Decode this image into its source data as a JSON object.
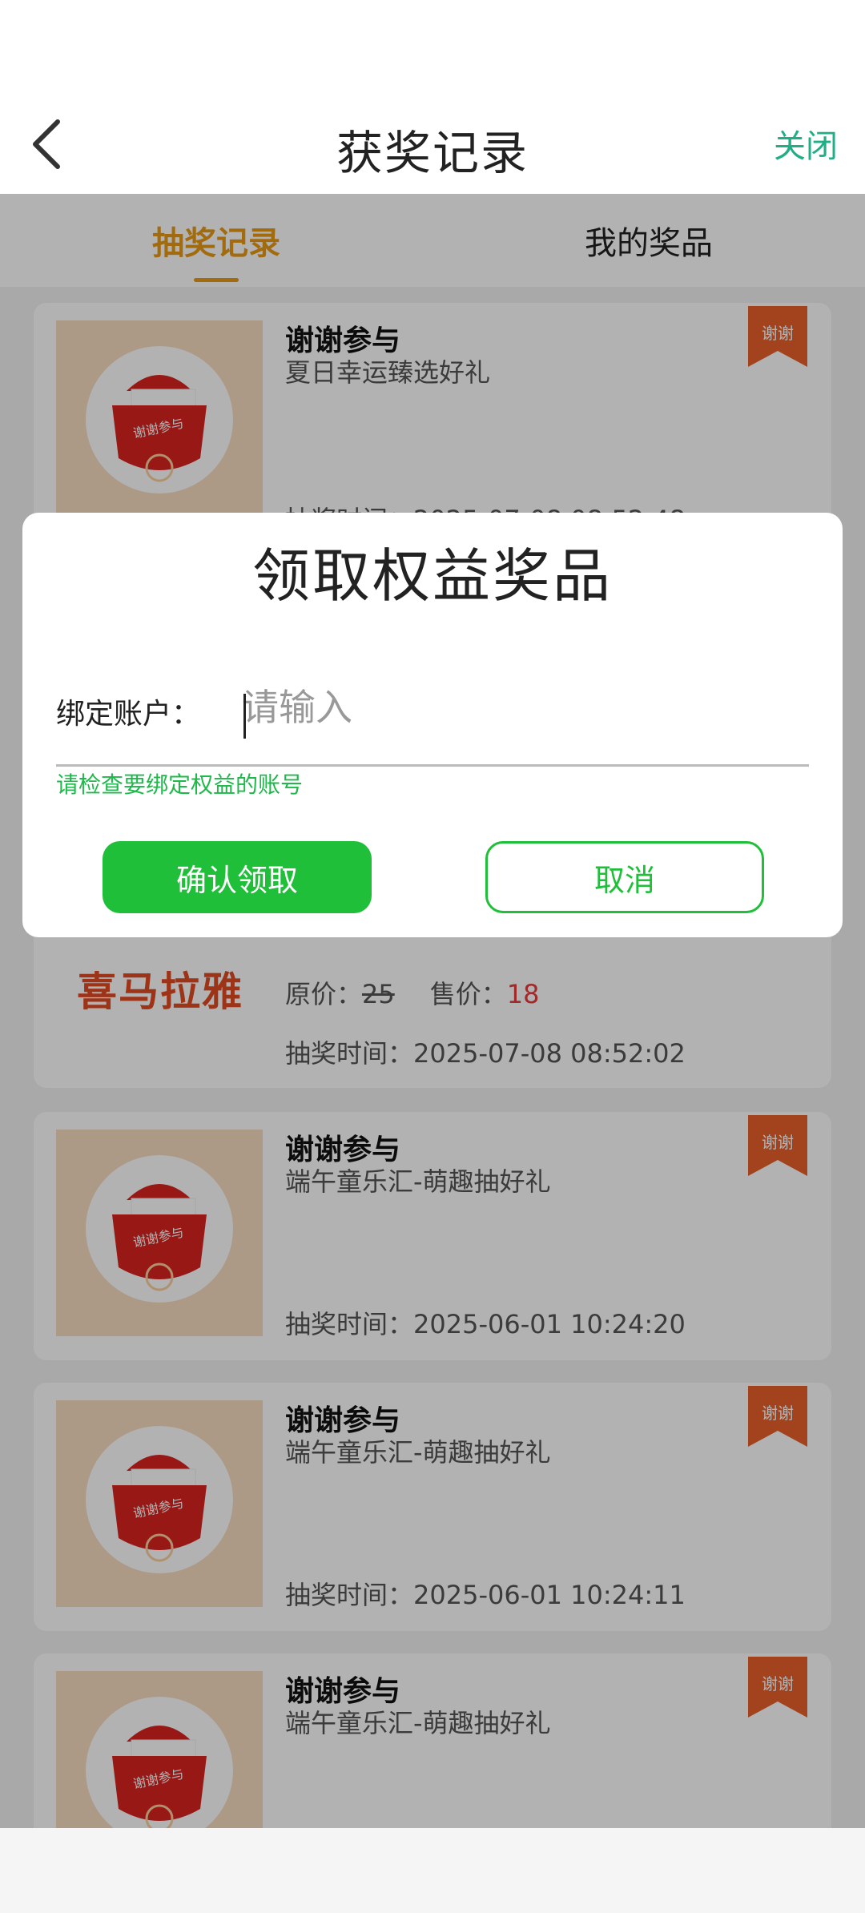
{
  "header": {
    "title": "获奖记录",
    "close_label": "关闭"
  },
  "tabs": [
    {
      "label": "抽奖记录",
      "active": true
    },
    {
      "label": "我的奖品",
      "active": false
    }
  ],
  "records": [
    {
      "title": "谢谢参与",
      "subtitle": "夏日幸运臻选好礼",
      "time": "抽奖时间：2025-07-08 08:52:48",
      "badge": "谢谢",
      "thumb_text": "谢谢参与"
    },
    {
      "logo_text": "喜马拉雅",
      "price_line": "原价：",
      "orig_price": "25",
      "sale_label": "售价：",
      "sale_price": "18",
      "time": "抽奖时间：2025-07-08 08:52:02"
    },
    {
      "title": "谢谢参与",
      "subtitle": "端午童乐汇-萌趣抽好礼",
      "time": "抽奖时间：2025-06-01 10:24:20",
      "badge": "谢谢",
      "thumb_text": "谢谢参与"
    },
    {
      "title": "谢谢参与",
      "subtitle": "端午童乐汇-萌趣抽好礼",
      "time": "抽奖时间：2025-06-01 10:24:11",
      "badge": "谢谢",
      "thumb_text": "谢谢参与"
    },
    {
      "title": "谢谢参与",
      "subtitle": "端午童乐汇-萌趣抽好礼",
      "badge": "谢谢",
      "thumb_text": "谢谢参与"
    }
  ],
  "dialog": {
    "title": "领取权益奖品",
    "field_label": "绑定账户：",
    "field_value": "",
    "field_placeholder": "请输入",
    "hint": "请检查要绑定权益的账号",
    "confirm_label": "确认领取",
    "cancel_label": "取消"
  },
  "colors": {
    "accent_orange": "#e89a14",
    "close_green": "#1fae86",
    "confirm_green": "#1fbf3a",
    "badge_orange": "#e8612c",
    "sale_red": "#e63b3b"
  },
  "icons": [
    "back-chevron-icon",
    "ribbon-badge-icon",
    "thank-you-card-illustration",
    "ximalaya-logo"
  ]
}
